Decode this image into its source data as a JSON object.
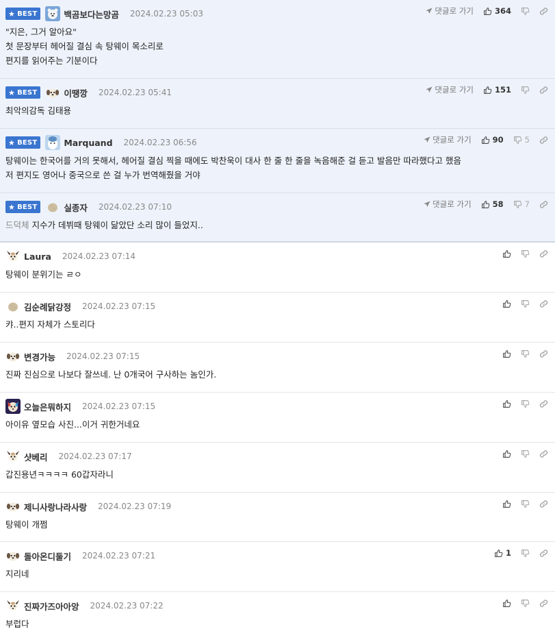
{
  "ui": {
    "best_label": "BEST",
    "reply_label": "댓글로 가기"
  },
  "comments": [
    {
      "best": true,
      "avatar": "polar-bear",
      "nick": "백곰보다는망곰",
      "date": "2024.02.23 05:03",
      "up": "364",
      "down": "",
      "lines": [
        "\"지은, 그거 알아요\"",
        "첫 문장부터 헤어질 결심 속 탕웨이 목소리로",
        "편지를 읽어주는 기분이다"
      ]
    },
    {
      "best": true,
      "avatar": "puppy",
      "nick": "이땡깡",
      "date": "2024.02.23 05:41",
      "up": "151",
      "down": "",
      "lines": [
        "최악의감독 김태용"
      ]
    },
    {
      "best": true,
      "avatar": "blue-character",
      "nick": "Marquand",
      "date": "2024.02.23 06:56",
      "up": "90",
      "down": "5",
      "lines": [
        "탕웨이는 한국어를 거의 못해서, 헤어질 결심 찍을 때에도 박찬욱이 대사 한 줄 한 줄을 녹음해준 걸 듣고 발음만 따라했다고 했음",
        "저 편지도 영어나 중국으로 쓴 걸 누가 번역해줬을 거야"
      ]
    },
    {
      "best": true,
      "avatar": "potato",
      "nick": "실종자",
      "date": "2024.02.23 07:10",
      "up": "58",
      "down": "7",
      "quote": "드덕체",
      "lines": [
        "지수가 데뷔때 탕웨이 닮았단 소리 많이 들었지.."
      ]
    },
    {
      "best": false,
      "avatar": "chihuahua",
      "nick": "Laura",
      "date": "2024.02.23 07:14",
      "up": "",
      "down": "",
      "lines": [
        "탕웨이 분위기는 ㄹㅇ"
      ]
    },
    {
      "best": false,
      "avatar": "potato",
      "nick": "김순례닭강정",
      "date": "2024.02.23 07:15",
      "up": "",
      "down": "",
      "lines": [
        "캬..편지 자체가 스토리다"
      ]
    },
    {
      "best": false,
      "avatar": "puppy",
      "nick": "변경가능",
      "date": "2024.02.23 07:15",
      "up": "",
      "down": "",
      "lines": [
        "진짜 진심으로 나보다 잘쓰네. 난 0개국어 구사하는 놈인가."
      ]
    },
    {
      "best": false,
      "avatar": "colorful-dog",
      "nick": "오늘은뭐하지",
      "date": "2024.02.23 07:15",
      "up": "",
      "down": "",
      "lines": [
        "아이유 옆모습 사진...이거 귀한거네요"
      ]
    },
    {
      "best": false,
      "avatar": "chihuahua",
      "nick": "샷베리",
      "date": "2024.02.23 07:17",
      "up": "",
      "down": "",
      "lines": [
        "갑진용년ㅋㅋㅋㅋ 60갑자라니"
      ]
    },
    {
      "best": false,
      "avatar": "puppy",
      "nick": "제니사랑나라사랑",
      "date": "2024.02.23 07:19",
      "up": "",
      "down": "",
      "lines": [
        "탕웨이 개쩜"
      ]
    },
    {
      "best": false,
      "avatar": "puppy",
      "nick": "돌아온디둘기",
      "date": "2024.02.23 07:21",
      "up": "1",
      "down": "",
      "lines": [
        "지리네"
      ]
    },
    {
      "best": false,
      "avatar": "chihuahua",
      "nick": "진짜가즈아아앙",
      "date": "2024.02.23 07:22",
      "up": "",
      "down": "",
      "lines": [
        "부럽다"
      ]
    }
  ]
}
